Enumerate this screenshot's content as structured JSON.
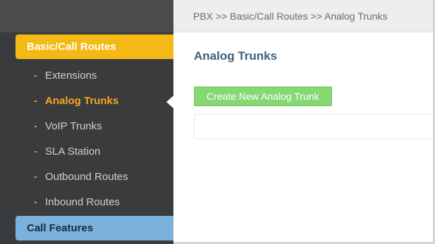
{
  "breadcrumb": {
    "text": "PBX >> Basic/Call Routes >> Analog Trunks"
  },
  "sidebar": {
    "section_active": {
      "label": "Basic/Call Routes"
    },
    "items": [
      {
        "dash": "-",
        "label": "Extensions",
        "active": false
      },
      {
        "dash": "-",
        "label": "Analog Trunks",
        "active": true
      },
      {
        "dash": "-",
        "label": "VoIP Trunks",
        "active": false
      },
      {
        "dash": "-",
        "label": "SLA Station",
        "active": false
      },
      {
        "dash": "-",
        "label": "Outbound Routes",
        "active": false
      },
      {
        "dash": "-",
        "label": "Inbound Routes",
        "active": false
      }
    ],
    "section_next": {
      "label": "Call Features"
    }
  },
  "main": {
    "title": "Analog Trunks",
    "create_button_label": "Create New Analog Trunk"
  },
  "colors": {
    "accent_orange": "#f5b915",
    "active_text": "#f5a623",
    "sidebar_bg": "#3a3b3c",
    "button_green": "#86d873",
    "title_blue": "#3b5f7c",
    "call_features_blue": "#7ab2dd"
  }
}
